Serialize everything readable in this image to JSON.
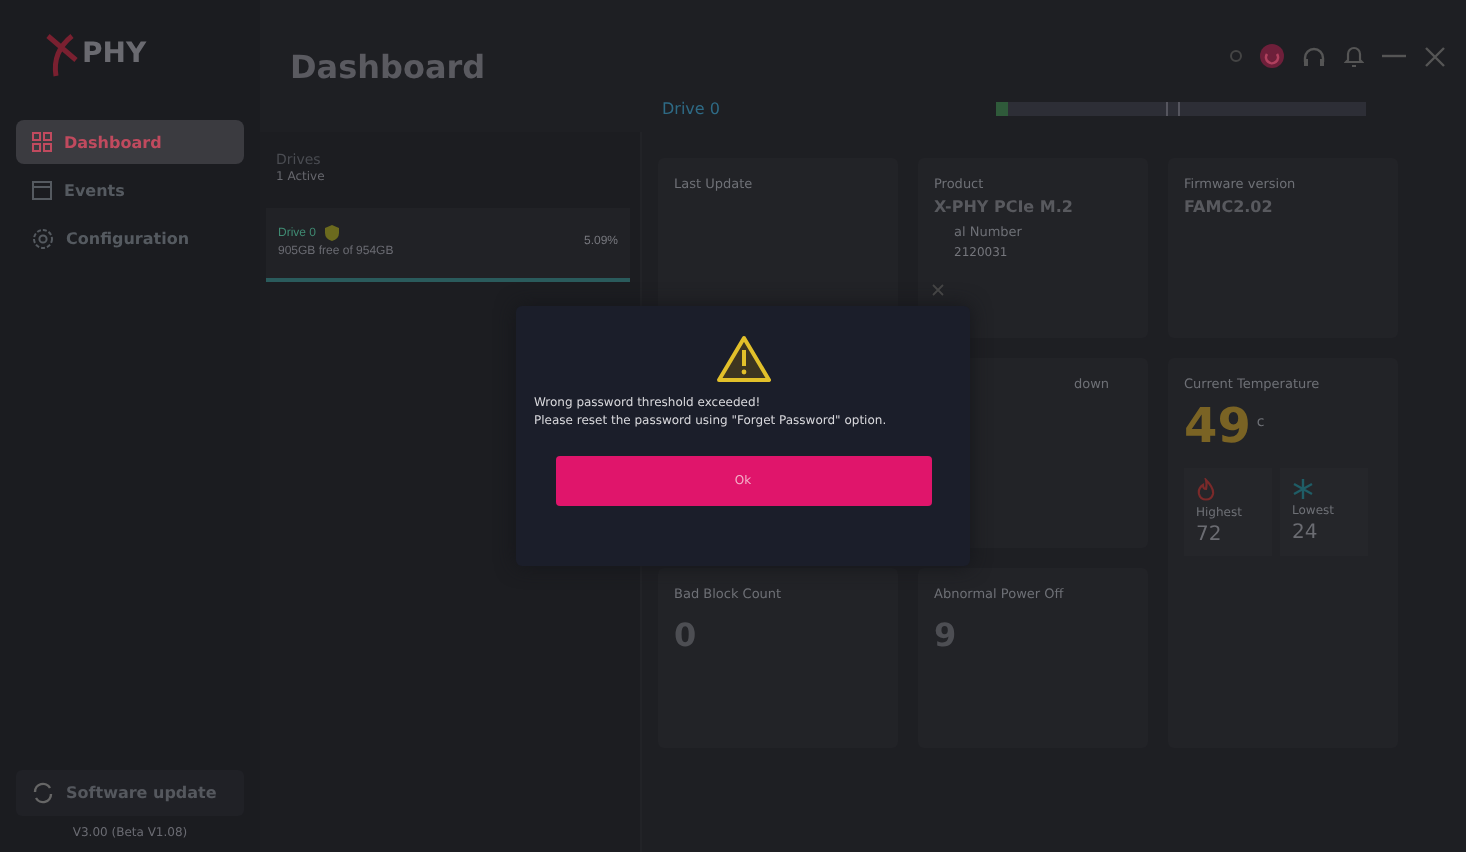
{
  "logo": "PHY",
  "header": {
    "title": "Dashboard"
  },
  "sidebar": {
    "items": [
      {
        "label": "Dashboard",
        "selected": true
      },
      {
        "label": "Events",
        "selected": false
      },
      {
        "label": "Configuration",
        "selected": false
      }
    ],
    "update_button": "Software update",
    "version": "V3.00 (Beta V1.08)"
  },
  "drives": {
    "title": "Drives",
    "subtitle": "1 Active",
    "items": [
      {
        "name": "Drive 0",
        "free": "905GB free of 954GB",
        "usage": "5.09%",
        "selected": true
      }
    ]
  },
  "drive_header": {
    "title": "Drive 0"
  },
  "cards": [
    {
      "label": "Last Update",
      "kind": "plain"
    },
    {
      "label": "Product",
      "value": "X-PHY PCIe M.2",
      "sub_label": "al Number",
      "sub_value": "2120031",
      "kind": "plain"
    },
    {
      "label": "Firmware version",
      "value": "FAMC2.02",
      "kind": "plain"
    },
    {
      "label": "down",
      "kind": "plain"
    },
    {
      "label": "Bad Block Count",
      "value": "0",
      "kind": "big"
    },
    {
      "label": "Abnormal Power Off",
      "value": "9",
      "kind": "big"
    }
  ],
  "temperature": {
    "label": "Current Temperature",
    "value": "49",
    "unit": "c",
    "highest_label": "Highest",
    "highest": "72",
    "lowest_label": "Lowest",
    "lowest": "24"
  },
  "dialog": {
    "message": "Wrong password threshold exceeded!\nPlease reset the password using \"Forget Password\" option.",
    "button": "Ok"
  }
}
